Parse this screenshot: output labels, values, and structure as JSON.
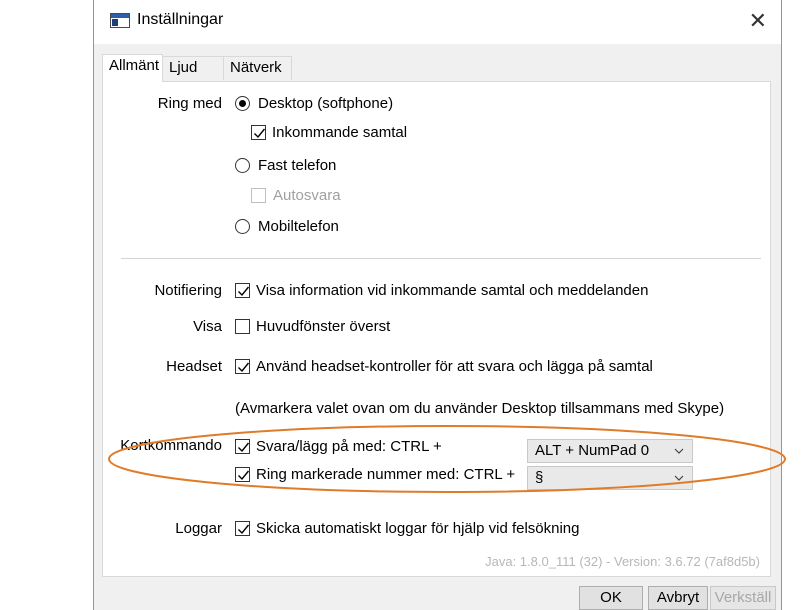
{
  "window": {
    "title": "Inställningar"
  },
  "tabs": [
    {
      "label": "Allmänt"
    },
    {
      "label": "Ljud"
    },
    {
      "label": "Nätverk"
    }
  ],
  "ring": {
    "label": "Ring med",
    "desktop": "Desktop (softphone)",
    "incoming": "Inkommande samtal",
    "fixed": "Fast telefon",
    "autoanswer": "Autosvara",
    "mobile": "Mobiltelefon"
  },
  "notify": {
    "label": "Notifiering",
    "text": "Visa information vid inkommande samtal och meddelanden"
  },
  "show": {
    "label": "Visa",
    "text": "Huvudfönster överst"
  },
  "headset": {
    "label": "Headset",
    "text": "Använd headset-kontroller för att svara och lägga på samtal",
    "note": "(Avmarkera valet ovan om du använder Desktop tillsammans med Skype)"
  },
  "shortcut": {
    "label": "Kortkommando",
    "answer_text": "Svara/lägg på med: CTRL +",
    "answer_value": "ALT + NumPad 0",
    "ring_text": "Ring markerade nummer med: CTRL +",
    "ring_value": "§"
  },
  "logs": {
    "label": "Loggar",
    "text": "Skicka automatiskt loggar för hjälp vid felsökning"
  },
  "version": "Java: 1.8.0_111 (32) - Version: 3.6.72 (7af8d5b)",
  "buttons": {
    "ok": "OK",
    "cancel": "Avbryt",
    "apply": "Verkställ"
  },
  "colors": {
    "highlight_ellipse": "#e07b28",
    "window_border": "#7a9cc2"
  }
}
